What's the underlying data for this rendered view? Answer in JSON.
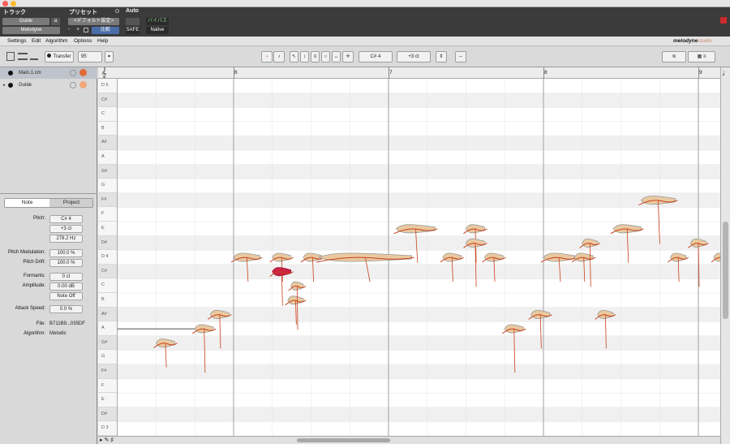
{
  "window": {
    "close_color": "#fc5f57",
    "min_color": "#fdbc2e",
    "max_color": "#28c840"
  },
  "protools": {
    "track_label": "トラック",
    "preset_label": "プリセット",
    "auto_label": "Auto",
    "track_name": "Guide",
    "track_letter": "a",
    "plugin_name": "Melodyne",
    "preset_value": "<デフォルト設定>",
    "compare_label": "比較",
    "bypass_label": "バイパス",
    "safe_label": "SAFE",
    "native_label": "Native",
    "minus": "-",
    "plus": "+"
  },
  "menu": {
    "items": [
      "Settings",
      "Edit",
      "Algorithm",
      "Options",
      "Help"
    ],
    "brand": "melodyne",
    "brand_suffix": "studio"
  },
  "toolbar": {
    "transfer_label": "Transfer",
    "tempo_value": "95",
    "pitch_display": "C# 4",
    "cents_display": "+3 ct"
  },
  "tracks": [
    {
      "name": "Main.1.cm"
    },
    {
      "name": "Guide"
    }
  ],
  "inspector": {
    "tab_note": "Note",
    "tab_project": "Project",
    "pitch_label": "Pitch:",
    "pitch_value": "C# 4",
    "cents_value": "+3 ct",
    "freq_value": "278.2 Hz",
    "pitch_mod_label": "Pitch Modulation:",
    "pitch_mod_value": "100.0 %",
    "pitch_drift_label": "Pitch Drift:",
    "pitch_drift_value": "100.0 %",
    "formants_label": "Formants:",
    "formants_value": "0 ct",
    "amplitude_label": "Amplitude:",
    "amplitude_value": "0.00 dB",
    "note_off_label": "Note Off",
    "attack_label": "Attack Speed:",
    "attack_value": "0.0 %",
    "file_label": "File:",
    "file_value": "B711B9...035DF",
    "algorithm_label": "Algorithm:",
    "algorithm_value": "Melodic"
  },
  "ruler": {
    "bars": [
      "6",
      "7",
      "8",
      "9"
    ]
  },
  "keys": [
    "D 5",
    "C#",
    "C",
    "B",
    "A#",
    "A",
    "G#",
    "G",
    "F#",
    "F",
    "E",
    "D#",
    "D 4",
    "C#",
    "C",
    "B",
    "A#",
    "A",
    "G#",
    "G",
    "F#",
    "F",
    "E",
    "D#",
    "D 3"
  ],
  "colors": {
    "note_fill": "#e9c9a0",
    "note_outline": "#d5501f",
    "pitch_line": "#c8401a",
    "highlight": "#cc2244"
  },
  "notes": [
    {
      "key": 12,
      "bar": 6.0,
      "len": 0.17
    },
    {
      "key": 12,
      "bar": 6.25,
      "len": 0.12
    },
    {
      "key": 13,
      "bar": 6.25,
      "len": 0.12,
      "highlight": true
    },
    {
      "key": 12,
      "bar": 6.45,
      "len": 0.12
    },
    {
      "key": 12,
      "bar": 6.55,
      "len": 0.6
    },
    {
      "key": 15,
      "bar": 6.35,
      "len": 0.1
    },
    {
      "key": 14,
      "bar": 6.37,
      "len": 0.08
    },
    {
      "key": 16,
      "bar": 5.85,
      "len": 0.12
    },
    {
      "key": 17,
      "bar": 5.75,
      "len": 0.12
    },
    {
      "key": 10,
      "bar": 7.05,
      "len": 0.25
    },
    {
      "key": 10,
      "bar": 7.5,
      "len": 0.12
    },
    {
      "key": 11,
      "bar": 7.5,
      "len": 0.12
    },
    {
      "key": 12,
      "bar": 7.35,
      "len": 0.12
    },
    {
      "key": 12,
      "bar": 7.62,
      "len": 0.12
    },
    {
      "key": 17,
      "bar": 7.75,
      "len": 0.12
    },
    {
      "key": 16,
      "bar": 7.92,
      "len": 0.12
    },
    {
      "key": 12,
      "bar": 8.0,
      "len": 0.2
    },
    {
      "key": 12,
      "bar": 8.2,
      "len": 0.12
    },
    {
      "key": 11,
      "bar": 8.25,
      "len": 0.1
    },
    {
      "key": 16,
      "bar": 8.35,
      "len": 0.1
    },
    {
      "key": 10,
      "bar": 8.45,
      "len": 0.18
    },
    {
      "key": 8,
      "bar": 8.63,
      "len": 0.22
    },
    {
      "key": 12,
      "bar": 8.82,
      "len": 0.1
    },
    {
      "key": 11,
      "bar": 8.95,
      "len": 0.1
    },
    {
      "key": 12,
      "bar": 9.1,
      "len": 0.1
    },
    {
      "key": 18,
      "bar": 5.5,
      "len": 0.12
    }
  ]
}
